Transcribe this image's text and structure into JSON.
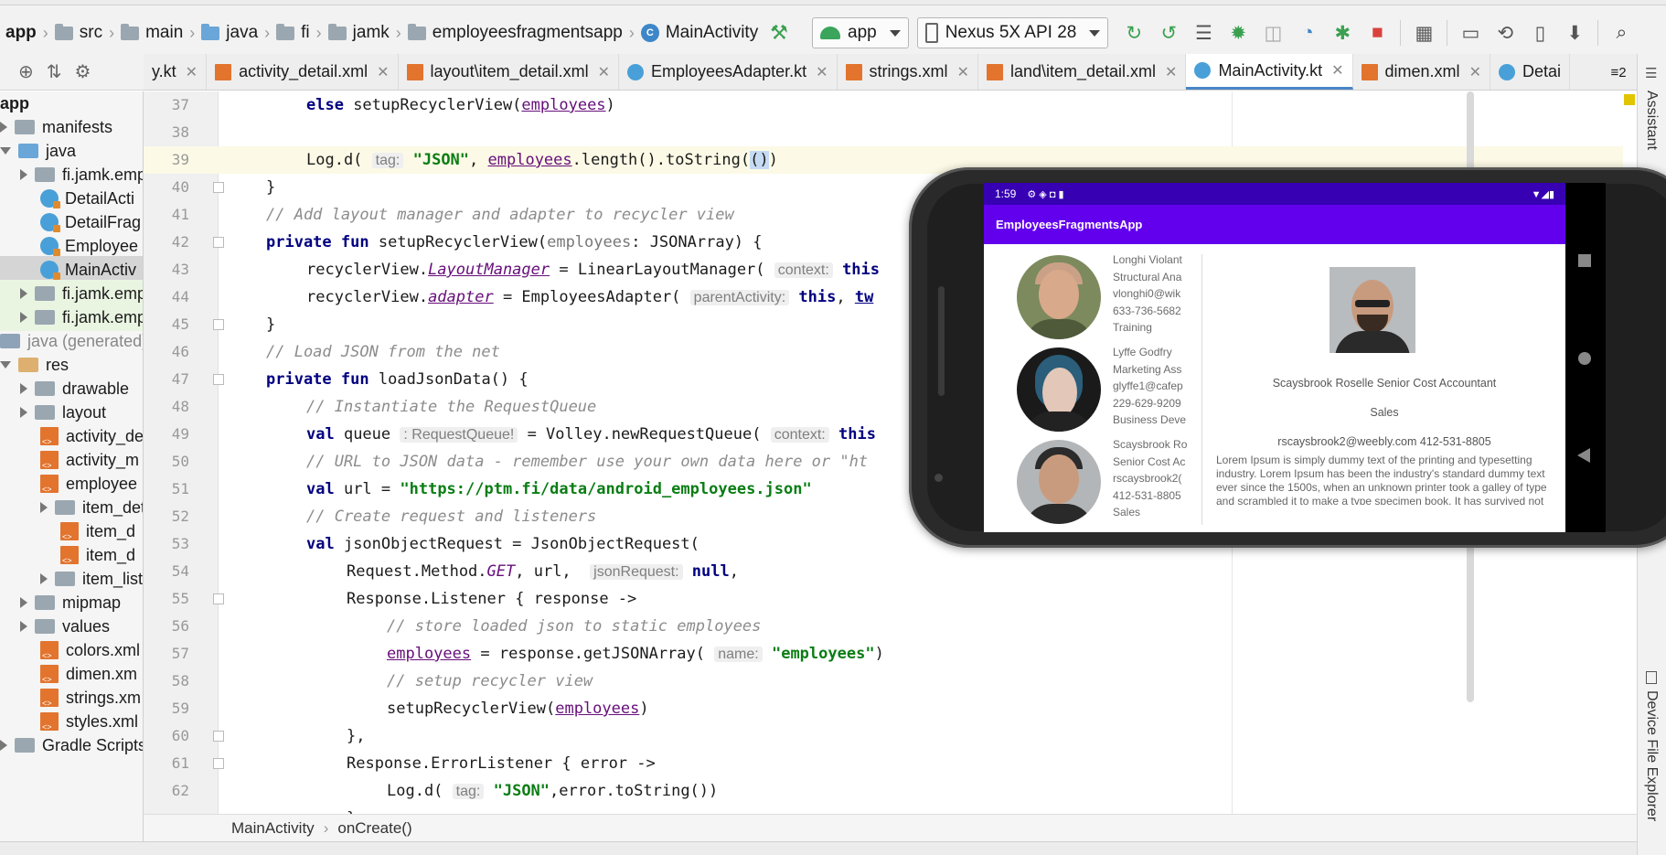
{
  "breadcrumbs": [
    "app",
    "src",
    "main",
    "java",
    "fi",
    "jamk",
    "employeesfragmentsapp",
    "MainActivity"
  ],
  "toolbar": {
    "run_config": "app",
    "device": "Nexus 5X API 28"
  },
  "project_tree": [
    {
      "label": "app",
      "level": 0,
      "kind": "bold"
    },
    {
      "label": "manifests",
      "level": 0,
      "kind": "folder"
    },
    {
      "label": "java",
      "level": 0,
      "kind": "folder-blue"
    },
    {
      "label": "fi.jamk.emplo",
      "level": 1,
      "kind": "package"
    },
    {
      "label": "DetailActi",
      "level": 2,
      "kind": "class"
    },
    {
      "label": "DetailFrag",
      "level": 2,
      "kind": "class"
    },
    {
      "label": "Employee",
      "level": 2,
      "kind": "class"
    },
    {
      "label": "MainActiv",
      "level": 2,
      "kind": "class",
      "selected": true
    },
    {
      "label": "fi.jamk.emplo",
      "level": 1,
      "kind": "package",
      "green": true
    },
    {
      "label": "fi.jamk.emplo",
      "level": 1,
      "kind": "package",
      "green": true
    },
    {
      "label": "java (generated)",
      "level": 0,
      "kind": "generated"
    },
    {
      "label": "res",
      "level": 0,
      "kind": "folder-orange"
    },
    {
      "label": "drawable",
      "level": 1,
      "kind": "folder"
    },
    {
      "label": "layout",
      "level": 1,
      "kind": "folder"
    },
    {
      "label": "activity_de",
      "level": 2,
      "kind": "xml"
    },
    {
      "label": "activity_m",
      "level": 2,
      "kind": "xml"
    },
    {
      "label": "employee",
      "level": 2,
      "kind": "xml"
    },
    {
      "label": "item_deta",
      "level": 2,
      "kind": "folder"
    },
    {
      "label": "item_d",
      "level": 3,
      "kind": "xml"
    },
    {
      "label": "item_d",
      "level": 3,
      "kind": "xml"
    },
    {
      "label": "item_list (",
      "level": 2,
      "kind": "folder"
    },
    {
      "label": "mipmap",
      "level": 1,
      "kind": "folder"
    },
    {
      "label": "values",
      "level": 1,
      "kind": "folder"
    },
    {
      "label": "colors.xml",
      "level": 2,
      "kind": "xml"
    },
    {
      "label": "dimen.xm",
      "level": 2,
      "kind": "xml"
    },
    {
      "label": "strings.xm",
      "level": 2,
      "kind": "xml"
    },
    {
      "label": "styles.xml",
      "level": 2,
      "kind": "xml"
    },
    {
      "label": "Gradle Scripts",
      "level": 0,
      "kind": "folder"
    }
  ],
  "tabs": [
    {
      "label": "y.kt",
      "type": "partial"
    },
    {
      "label": "activity_detail.xml",
      "type": "xml"
    },
    {
      "label": "layout\\item_detail.xml",
      "type": "xml"
    },
    {
      "label": "EmployeesAdapter.kt",
      "type": "kt"
    },
    {
      "label": "strings.xml",
      "type": "xml"
    },
    {
      "label": "land\\item_detail.xml",
      "type": "xml"
    },
    {
      "label": "MainActivity.kt",
      "type": "kt",
      "active": true
    },
    {
      "label": "dimen.xml",
      "type": "xml"
    },
    {
      "label": "Detai",
      "type": "kt"
    }
  ],
  "tabs_overflow": "≡2",
  "right_strip": {
    "top": "Assistant",
    "bottom": "Device File Explorer"
  },
  "code": {
    "line_numbers": [
      "37",
      "38",
      "39",
      "40",
      "41",
      "42",
      "43",
      "44",
      "45",
      "46",
      "47",
      "48",
      "49",
      "50",
      "51",
      "52",
      "53",
      "54",
      "55",
      "56",
      "57",
      "58",
      "59",
      "60",
      "61",
      "62"
    ],
    "kw_else": "else",
    "t_setup1": " setupRecyclerView(",
    "p_employees": "employees",
    "t_close_paren": ")",
    "t_logd": "Log.d(",
    "h_tag": "tag:",
    "s_json": "\"JSON\"",
    "t_comma_sp": ", ",
    "t_length": ".length().toString(",
    "t_sel": "()",
    "t_sel_close": ")",
    "t_brace_close": "}",
    "c_add_layout": "// Add layout manager and adapter to recycler view",
    "kw_private": "private",
    "kw_fun": "fun",
    "t_setup_sig": " setupRecyclerView(",
    "t_param_employees": "employees",
    "t_jsonarray": ": JSONArray) {",
    "t_rv": "recyclerView.",
    "p_layout_manager": "LayoutManager",
    "t_llm": " = LinearLayoutManager(",
    "h_context": "context:",
    "kw_this": "this",
    "p_adapter": "adapter",
    "t_empadapter": " = EmployeesAdapter(",
    "h_parent": "parentActivity:",
    "t_comma": ", ",
    "kw_tw": "tw",
    "c_load_json": "// Load JSON from the net",
    "t_load_sig": " loadJsonData() {",
    "c_instantiate": "// Instantiate the RequestQueue",
    "kw_val": "val",
    "t_queue": " queue ",
    "h_requestqueue": ": RequestQueue!",
    "t_volley": " = Volley.newRequestQueue(",
    "c_url": "// URL to JSON data - remember use your own data here or \"ht",
    "t_url": " url = ",
    "s_url": "\"https://ptm.fi/data/android_employees.json\"",
    "c_create": "// Create request and listeners",
    "t_jor": " jsonObjectRequest = JsonObjectRequest(",
    "t_request_method": "Request.Method.",
    "i_get": "GET",
    "t_url_arg": ", url, ",
    "h_json_request": "jsonRequest:",
    "kw_null": "null",
    "t_comma_end": ",",
    "t_listener": "Response.Listener { response ->",
    "c_store": "// store loaded json to static employees",
    "t_getarray": " = response.getJSONArray(",
    "h_name": "name:",
    "s_employees": "\"employees\"",
    "c_setup_rv": "// setup recycler view",
    "t_setup_call": "setupRecyclerView(",
    "t_close_brace_comma": "},",
    "t_errorlistener": "Response.ErrorListener { error ->",
    "t_logd2": "Log.d(",
    "s_json2": "\"JSON\"",
    "t_error": ",error.toString())",
    "t_trailing": "}"
  },
  "code_crumbs": [
    "MainActivity",
    "onCreate()"
  ],
  "emulator": {
    "status_time": "1:59",
    "status_icons": "⚙ ◈ ◘ ▮",
    "app_title": "EmployeesFragmentsApp",
    "employees": [
      {
        "lines": [
          "Longhi Violant",
          "Structural Ana",
          "vlonghi0@wik",
          "633-736-5682",
          "Training"
        ]
      },
      {
        "lines": [
          "Lyffe Godfry",
          "Marketing Ass",
          "glyffe1@cafep",
          "229-629-9209",
          "Business Deve"
        ]
      },
      {
        "lines": [
          "Scaysbrook Ro",
          "Senior Cost Ac",
          "rscaysbrook2(",
          "412-531-8805",
          "Sales"
        ]
      }
    ],
    "detail": {
      "name_title": "Scaysbrook Roselle  Senior Cost Accountant",
      "department": "Sales",
      "contact": "rscaysbrook2@weebly.com  412-531-8805",
      "lorem": "Lorem Ipsum is simply dummy text of the printing and typesetting industry. Lorem Ipsum has been the industry's standard dummy text ever since the 1500s, when an unknown printer took a galley of type and scrambled it to make a type specimen book. It has survived not only five"
    }
  }
}
